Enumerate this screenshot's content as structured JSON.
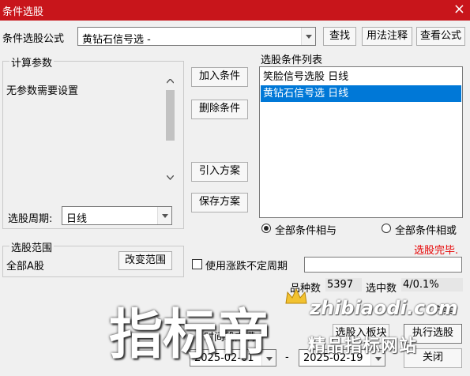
{
  "window": {
    "title": "条件选股",
    "close_glyph": "×"
  },
  "formula": {
    "label": "条件选股公式",
    "value": "黄钻石信号选  -",
    "find_button": "查找",
    "usage_button": "用法注释",
    "view_button": "查看公式"
  },
  "params": {
    "legend": "计算参数",
    "text": "无参数需要设置",
    "period_label": "选股周期:",
    "period_value": "日线"
  },
  "actions": {
    "add": "加入条件",
    "delete": "删除条件",
    "import": "引入方案",
    "save": "保存方案"
  },
  "conditions": {
    "title": "选股条件列表",
    "items": [
      "笑脸信号选股  日线",
      "黄钻石信号选  日线"
    ],
    "selected_index": 1,
    "and_label": "全部条件相与",
    "or_label": "全部条件相或",
    "status": "选股完毕."
  },
  "scope": {
    "legend": "选股范围",
    "value": "全部A股",
    "change_button": "改变范围"
  },
  "options": {
    "uncertain_label": "使用涨跌不定周期"
  },
  "stats": {
    "count_label": "品种数",
    "count_value": "5397",
    "hit_label": "选中数",
    "hit_value": "4/0.1%"
  },
  "bottom": {
    "range_label": "时间段内满",
    "right_label": "方案",
    "to_block_button": "选股入板块",
    "run_button": "执行选股",
    "close_button": "关闭",
    "start_date": "2025-02-01",
    "dash": "-",
    "end_date": "2025-02-19"
  },
  "watermark": {
    "big_text": "指标帝",
    "url_text": "zhibiaodi.com",
    "site_text": "精品指标网站",
    "color": "#ffffff",
    "crown_color": "#f2c230"
  },
  "colors": {
    "title_bg": "#c8151b",
    "selection": "#0078d7",
    "status_red": "#e60000"
  }
}
